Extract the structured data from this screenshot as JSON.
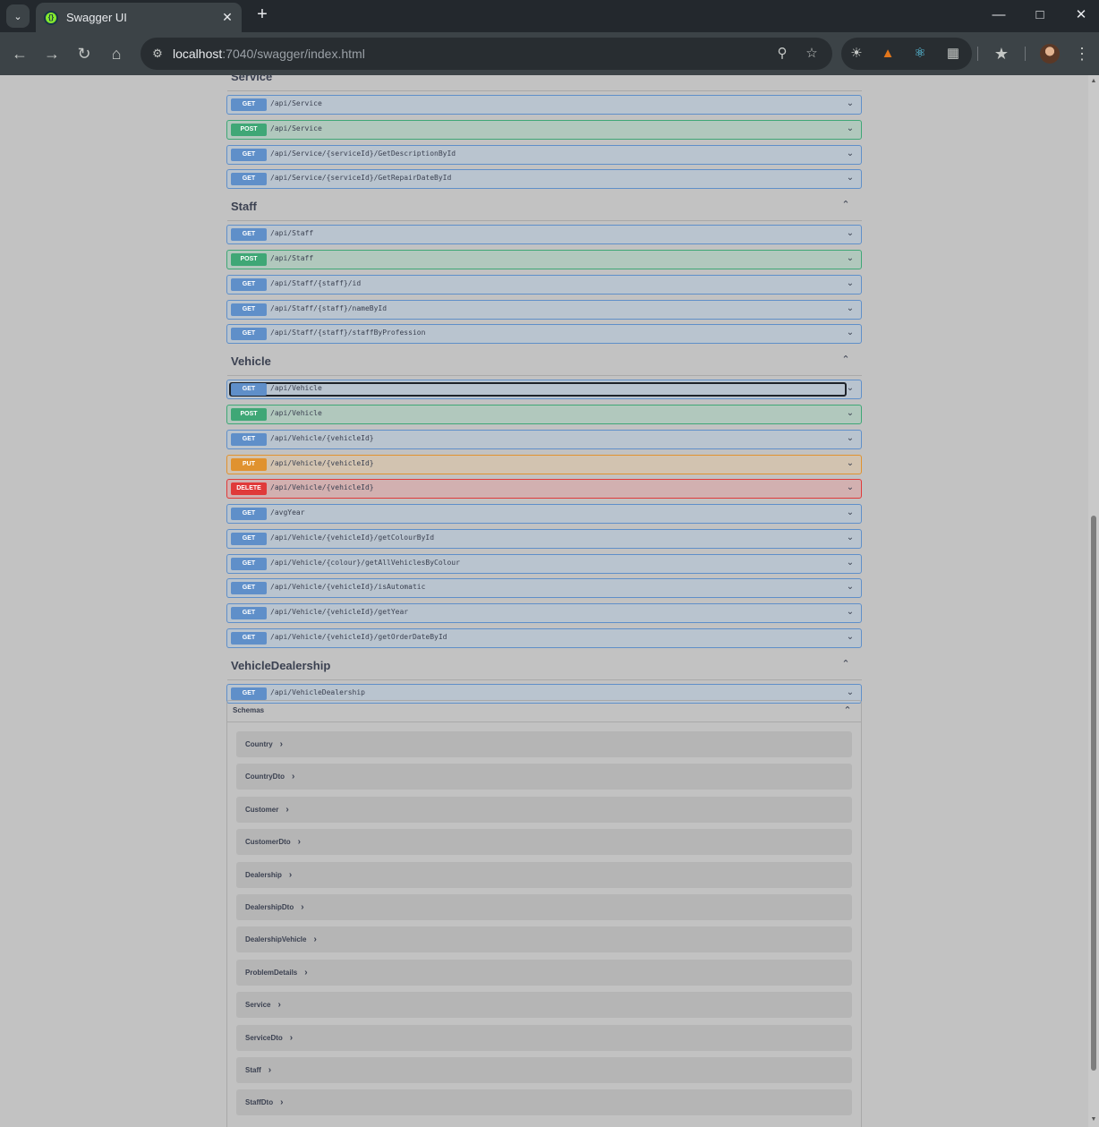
{
  "browser": {
    "tab_title": "Swagger UI",
    "favicon_glyph": "{}",
    "url_host": "localhost",
    "url_rest": ":7040/swagger/index.html"
  },
  "tags": [
    {
      "name": "Service",
      "ops": [
        {
          "method": "GET",
          "path": "/api/Service"
        },
        {
          "method": "POST",
          "path": "/api/Service"
        },
        {
          "method": "GET",
          "path": "/api/Service/{serviceId}/GetDescriptionById"
        },
        {
          "method": "GET",
          "path": "/api/Service/{serviceId}/GetRepairDateById"
        }
      ]
    },
    {
      "name": "Staff",
      "ops": [
        {
          "method": "GET",
          "path": "/api/Staff"
        },
        {
          "method": "POST",
          "path": "/api/Staff"
        },
        {
          "method": "GET",
          "path": "/api/Staff/{staff}/id"
        },
        {
          "method": "GET",
          "path": "/api/Staff/{staff}/nameById"
        },
        {
          "method": "GET",
          "path": "/api/Staff/{staff}/staffByProfession"
        }
      ]
    },
    {
      "name": "Vehicle",
      "ops": [
        {
          "method": "GET",
          "path": "/api/Vehicle",
          "focused": true
        },
        {
          "method": "POST",
          "path": "/api/Vehicle"
        },
        {
          "method": "GET",
          "path": "/api/Vehicle/{vehicleId}"
        },
        {
          "method": "PUT",
          "path": "/api/Vehicle/{vehicleId}"
        },
        {
          "method": "DELETE",
          "path": "/api/Vehicle/{vehicleId}"
        },
        {
          "method": "GET",
          "path": "/avgYear"
        },
        {
          "method": "GET",
          "path": "/api/Vehicle/{vehicleId}/getColourById"
        },
        {
          "method": "GET",
          "path": "/api/Vehicle/{colour}/getAllVehiclesByColour"
        },
        {
          "method": "GET",
          "path": "/api/Vehicle/{vehicleId}/isAutomatic"
        },
        {
          "method": "GET",
          "path": "/api/Vehicle/{vehicleId}/getYear"
        },
        {
          "method": "GET",
          "path": "/api/Vehicle/{vehicleId}/getOrderDateById"
        }
      ]
    },
    {
      "name": "VehicleDealership",
      "ops": [
        {
          "method": "GET",
          "path": "/api/VehicleDealership"
        }
      ]
    }
  ],
  "schemas": {
    "title": "Schemas",
    "models": [
      "Country",
      "CountryDto",
      "Customer",
      "CustomerDto",
      "Dealership",
      "DealershipDto",
      "DealershipVehicle",
      "ProblemDetails",
      "Service",
      "ServiceDto",
      "Staff",
      "StaffDto"
    ]
  },
  "colors": {
    "get": "#5f8fc9",
    "post": "#3fa776",
    "put": "#e0922f",
    "delete": "#e03a3a"
  }
}
